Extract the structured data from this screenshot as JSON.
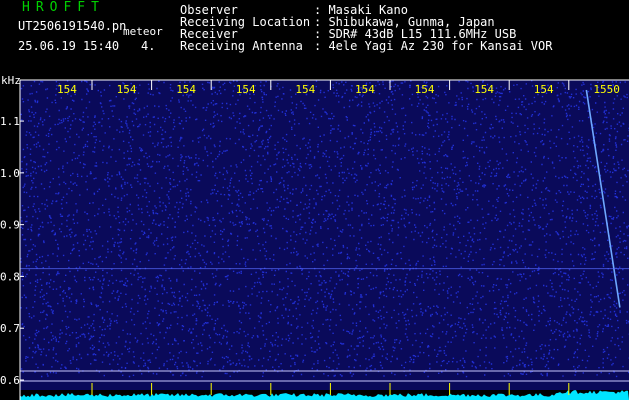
{
  "header": {
    "app_title": "HROFFT",
    "filename": "UT2506191540.pn",
    "tag": "meteor",
    "datetime": "25.06.19 15:40",
    "index": "4."
  },
  "station": [
    {
      "key": "Observer",
      "value": ": Masaki Kano"
    },
    {
      "key": "Receiving Location",
      "value": ": Shibukawa, Gunma, Japan"
    },
    {
      "key": "Receiver",
      "value": ": SDR# 43dB L15 111.6MHz USB"
    },
    {
      "key": "Receiving Antenna",
      "value": ": 4ele Yagi Az 230 for Kansai VOR"
    }
  ],
  "chart_data": {
    "type": "heatmap",
    "title": "",
    "ylabel": "kHz",
    "y_ticks": [
      "1.1",
      "1.0",
      "0.9",
      "0.8",
      "0.7",
      "0.6"
    ],
    "ylim": [
      0.6,
      1.16
    ],
    "time_labels": [
      "154",
      "154",
      "154",
      "154",
      "154",
      "154",
      "154",
      "154",
      "154",
      "1550"
    ],
    "background_color": "#0a0a5a",
    "noise_color": "#2a3cff",
    "trace_color": "#6ea8ff",
    "spectrum_color": "#00e5ff",
    "events": [
      {
        "kind": "meteor-trace",
        "time_start": 0.93,
        "time_end": 0.985,
        "khz_start": 1.16,
        "khz_end": 0.74
      },
      {
        "kind": "carrier",
        "khz": 0.815
      }
    ]
  }
}
